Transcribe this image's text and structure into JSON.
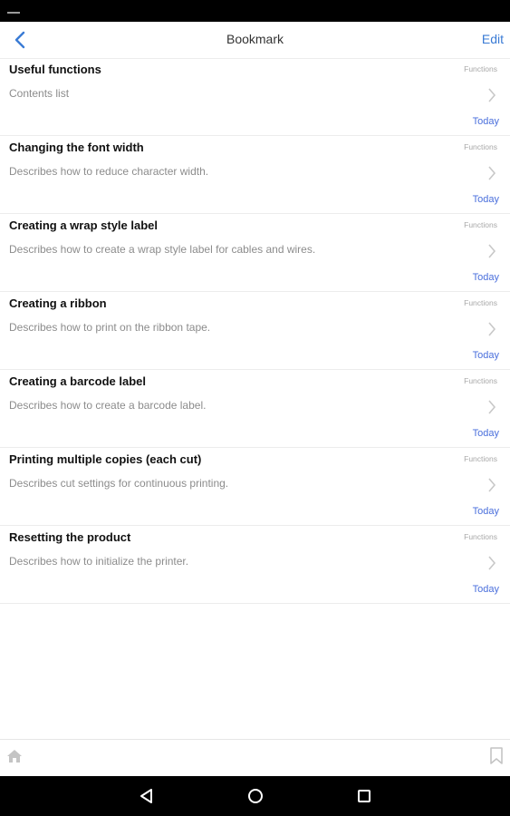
{
  "header": {
    "title": "Bookmark",
    "edit_label": "Edit",
    "back_icon": "chevron-left-icon"
  },
  "bookmarks": [
    {
      "title": "Useful functions",
      "description": "Contents list",
      "category": "Functions",
      "date": "Today"
    },
    {
      "title": "Changing the font width",
      "description": "Describes how to reduce character width.",
      "category": "Functions",
      "date": "Today"
    },
    {
      "title": "Creating a wrap style label",
      "description": "Describes how to create a wrap style label for cables and wires.",
      "category": "Functions",
      "date": "Today"
    },
    {
      "title": "Creating a ribbon",
      "description": "Describes how to print on the ribbon tape.",
      "category": "Functions",
      "date": "Today"
    },
    {
      "title": "Creating a barcode label",
      "description": "Describes how to create a barcode label.",
      "category": "Functions",
      "date": "Today"
    },
    {
      "title": "Printing multiple copies (each cut)",
      "description": "Describes cut settings for continuous printing.",
      "category": "Functions",
      "date": "Today"
    },
    {
      "title": "Resetting the product",
      "description": "Describes how to initialize the printer.",
      "category": "Functions",
      "date": "Today"
    }
  ],
  "bottom_bar": {
    "left_icon": "home-icon",
    "right_icon": "bookmark-icon"
  },
  "nav_bar": {
    "icons": [
      "back-triangle-icon",
      "home-circle-icon",
      "recents-square-icon"
    ]
  },
  "colors": {
    "accent": "#3a7bd5",
    "date": "#4a6fdc",
    "title_text": "#111111",
    "secondary_text": "#8c8c8c"
  }
}
